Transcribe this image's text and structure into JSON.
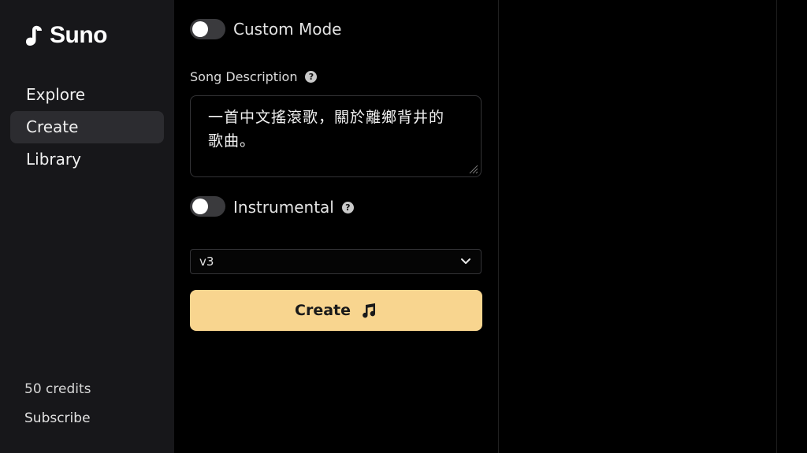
{
  "sidebar": {
    "logo_text": "Suno",
    "nav": [
      {
        "label": "Explore"
      },
      {
        "label": "Create",
        "active": true
      },
      {
        "label": "Library"
      }
    ],
    "credits": "50 credits",
    "subscribe": "Subscribe"
  },
  "main": {
    "custom_mode": {
      "label": "Custom Mode",
      "on": false
    },
    "song_description": {
      "label": "Song Description",
      "value_line1": "一首中文搖滾歌，關於離鄉背井的",
      "value_line2": "歌曲。"
    },
    "instrumental": {
      "label": "Instrumental",
      "on": false
    },
    "model_select": {
      "value": "v3"
    },
    "create_button": {
      "label": "Create"
    }
  },
  "colors": {
    "accent": "#f8d58f",
    "sidebar_bg": "#17171a",
    "page_bg": "#000000"
  },
  "icons": [
    "suno-logo-icon",
    "help-icon",
    "chevron-down-icon",
    "music-note-icon",
    "resize-handle-icon"
  ]
}
